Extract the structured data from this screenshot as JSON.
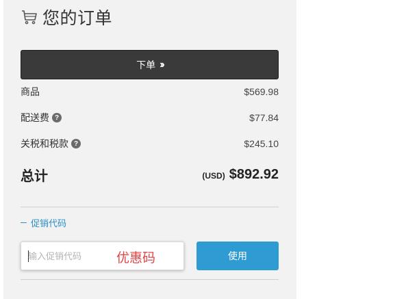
{
  "header": {
    "title": "您的订单",
    "icon": "cart-icon"
  },
  "place_order": {
    "label": "下单",
    "icon": "double-chevron-right-icon"
  },
  "summary": {
    "items": [
      {
        "label": "商品",
        "value": "$569.98",
        "has_help": false
      },
      {
        "label": "配送费",
        "value": "$77.84",
        "has_help": true
      },
      {
        "label": "关税和税款",
        "value": "$245.10",
        "has_help": true
      }
    ],
    "help_glyph": "?"
  },
  "total": {
    "label": "总计",
    "currency": "(USD)",
    "amount": "$892.92"
  },
  "promo": {
    "toggle_label": "促销代码",
    "placeholder": "输入促销代码",
    "annotation": "优惠码",
    "apply_label": "使用"
  },
  "colors": {
    "panel_bg": "#f2f2f2",
    "primary_button": "#3a3a3a",
    "apply_button": "#2e9bd3",
    "link": "#2a8fc4",
    "annotation": "#e04646"
  }
}
